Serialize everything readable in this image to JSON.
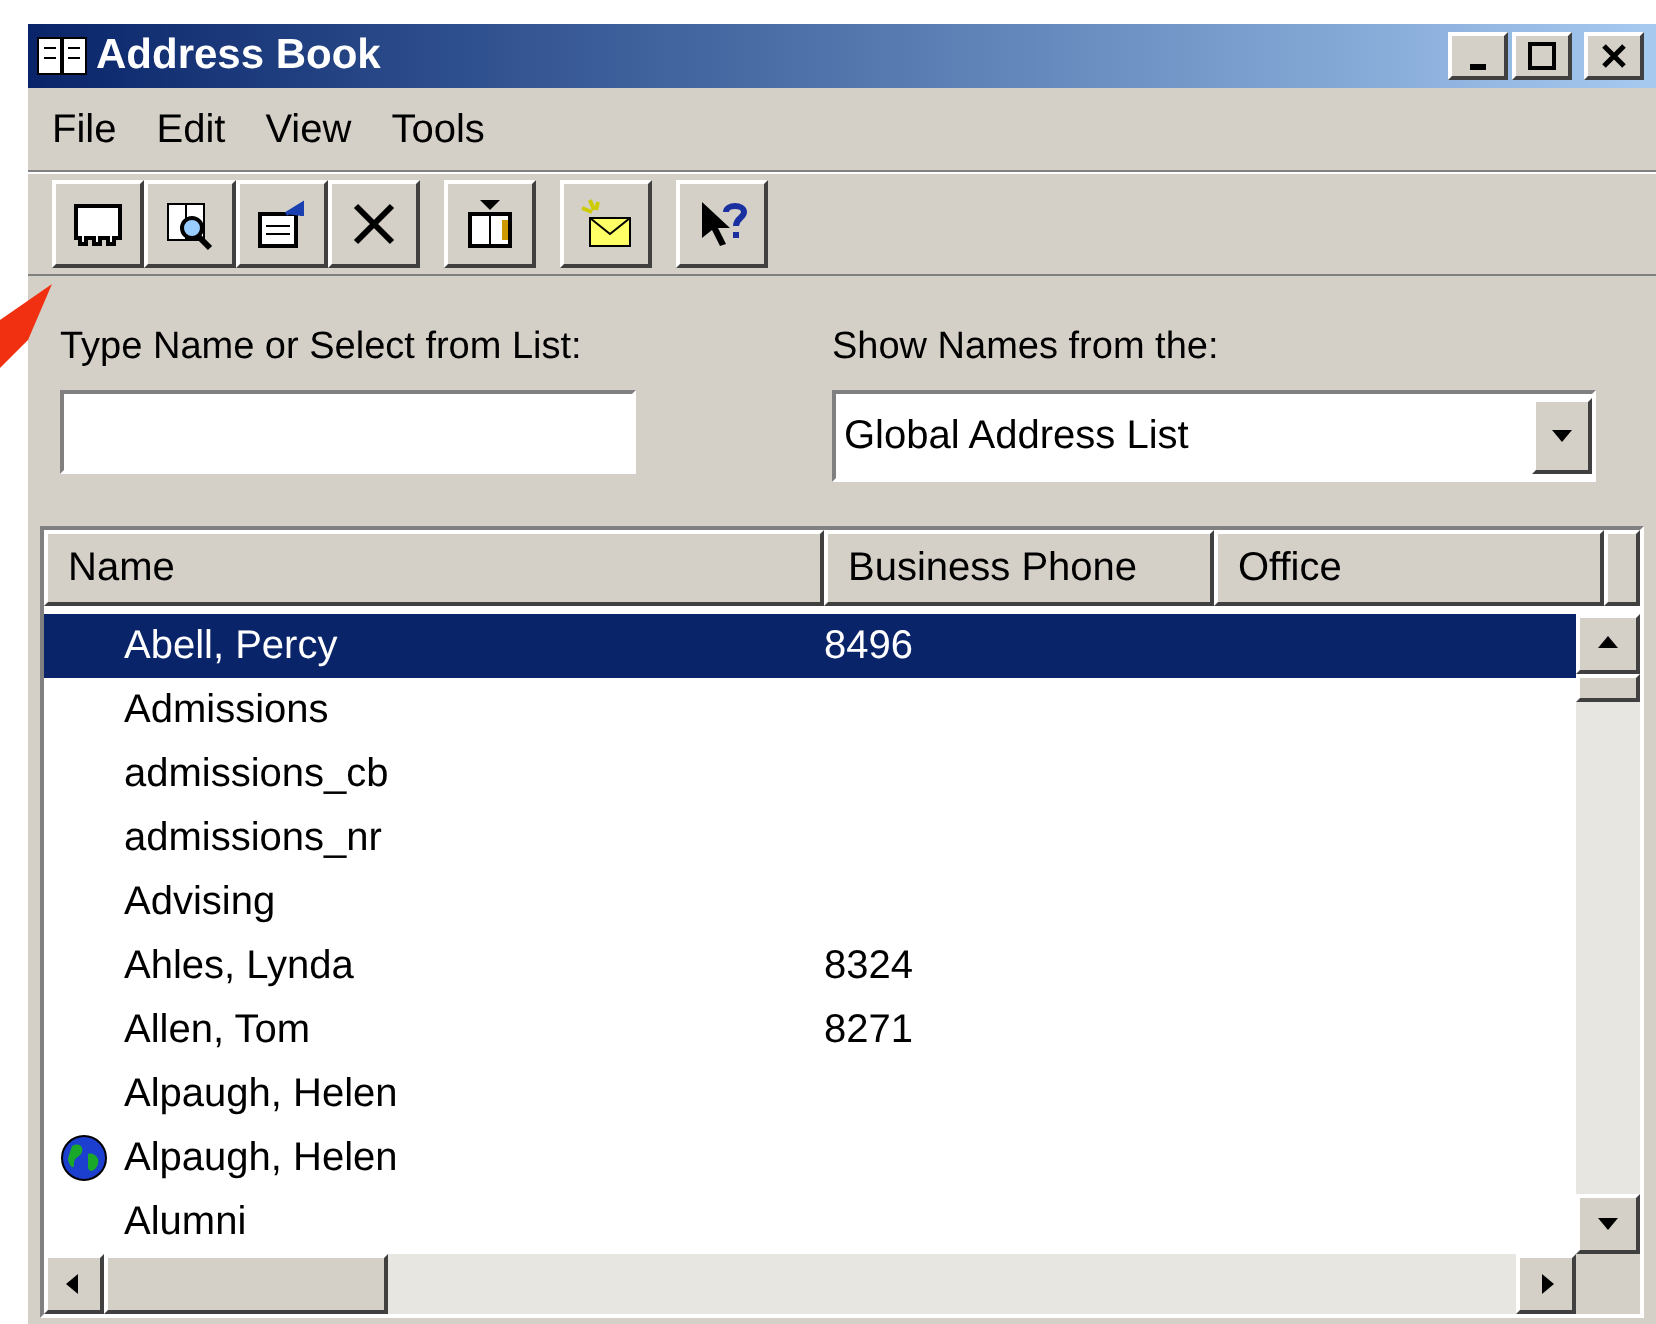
{
  "window": {
    "title": "Address Book"
  },
  "menu": [
    "File",
    "Edit",
    "View",
    "Tools"
  ],
  "search": {
    "label": "Type Name or Select from List:"
  },
  "source": {
    "label": "Show Names from the:",
    "value": "Global Address List"
  },
  "table": {
    "columns": [
      "Name",
      "Business Phone",
      "Office"
    ],
    "rows": [
      {
        "kind": "contact",
        "name": "Abell, Percy",
        "phone": "8496",
        "selected": true
      },
      {
        "kind": "contact",
        "name": "Admissions",
        "selected": false
      },
      {
        "kind": "contact",
        "name": "admissions_cb",
        "selected": false
      },
      {
        "kind": "contact",
        "name": "admissions_nr",
        "selected": false
      },
      {
        "kind": "contact",
        "name": "Advising",
        "selected": false
      },
      {
        "kind": "contact",
        "name": "Ahles, Lynda",
        "phone": "8324",
        "selected": false
      },
      {
        "kind": "contact",
        "name": "Allen, Tom",
        "phone": "8271",
        "selected": false
      },
      {
        "kind": "contact",
        "name": "Alpaugh, Helen",
        "selected": false
      },
      {
        "kind": "internet",
        "name": "Alpaugh, Helen",
        "selected": false
      },
      {
        "kind": "contact",
        "name": "Alumni",
        "selected": false
      }
    ]
  }
}
